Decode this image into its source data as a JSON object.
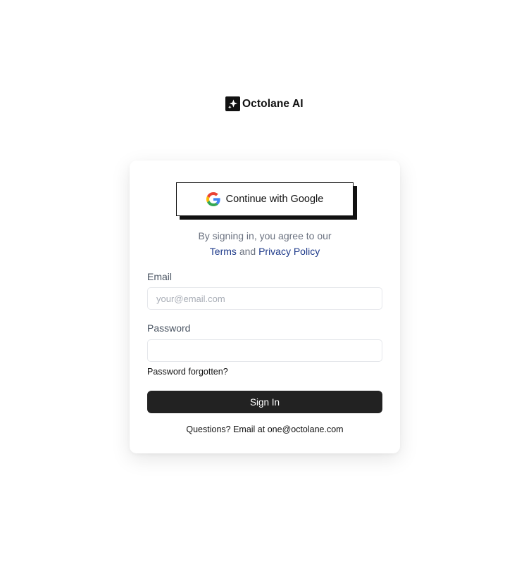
{
  "brand": {
    "name": "Octolane AI"
  },
  "google_button": {
    "label": "Continue with Google"
  },
  "agreement": {
    "prefix": "By signing in, you agree to our",
    "terms": "Terms",
    "and": "and",
    "privacy": "Privacy Policy"
  },
  "form": {
    "email_label": "Email",
    "email_placeholder": "your@email.com",
    "email_value": "",
    "password_label": "Password",
    "password_value": "",
    "forgot_label": "Password forgotten?",
    "submit_label": "Sign In"
  },
  "footer": {
    "questions": "Questions? Email at one@octolane.com"
  },
  "colors": {
    "button_dark": "#222222",
    "link": "#1e3a8a",
    "muted": "#6b7280"
  }
}
